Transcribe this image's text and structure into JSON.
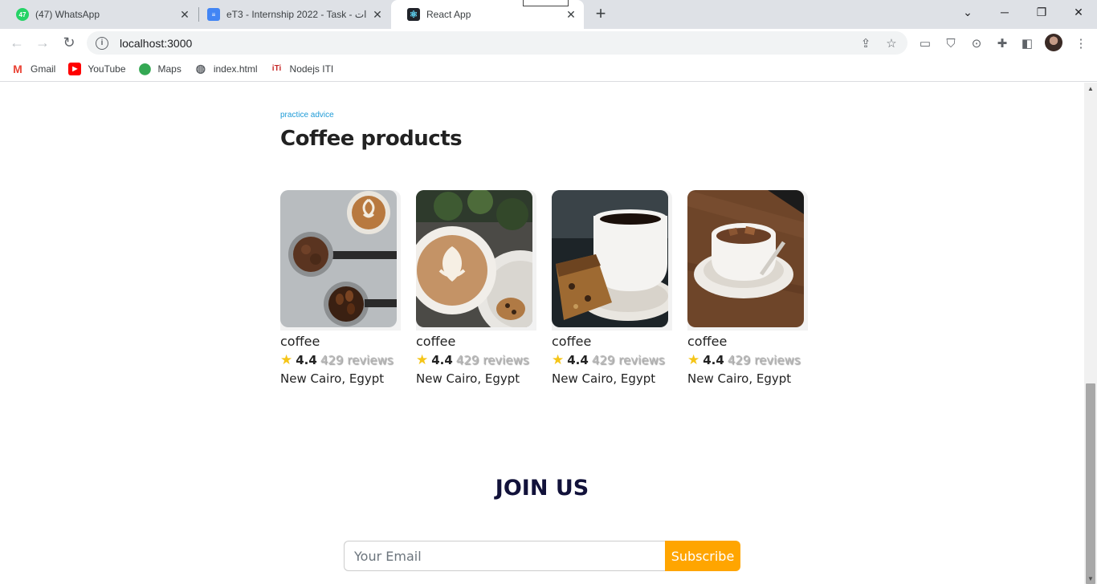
{
  "browser": {
    "tabs": [
      {
        "title": "(47) WhatsApp",
        "badge": "47",
        "favicon": "whatsapp-icon"
      },
      {
        "title": "eT3 - Internship 2022 - Task - ات",
        "favicon": "google-docs-icon"
      },
      {
        "title": "React App",
        "favicon": "react-icon"
      }
    ],
    "url": "localhost:3000",
    "bookmarks": [
      {
        "label": "Gmail",
        "icon": "gmail-icon"
      },
      {
        "label": "YouTube",
        "icon": "youtube-icon"
      },
      {
        "label": "Maps",
        "icon": "maps-icon"
      },
      {
        "label": "index.html",
        "icon": "globe-icon"
      },
      {
        "label": "Nodejs ITI",
        "icon": "iti-icon"
      }
    ]
  },
  "section": {
    "eyebrow": "practice advice",
    "title": "Coffee products"
  },
  "products": [
    {
      "name": "coffee",
      "rating": "4.4",
      "reviews": "429 reviews",
      "location": "New Cairo, Egypt",
      "image": "coffee-tools-photo"
    },
    {
      "name": "coffee",
      "rating": "4.4",
      "reviews": "429 reviews",
      "location": "New Cairo, Egypt",
      "image": "latte-art-photo"
    },
    {
      "name": "coffee",
      "rating": "4.4",
      "reviews": "429 reviews",
      "location": "New Cairo, Egypt",
      "image": "coffee-cake-photo"
    },
    {
      "name": "coffee",
      "rating": "4.4",
      "reviews": "429 reviews",
      "location": "New Cairo, Egypt",
      "image": "cup-on-table-photo"
    }
  ],
  "join": {
    "title": "JOIN US",
    "email_placeholder": "Your Email",
    "subscribe_label": "Subscribe"
  },
  "colors": {
    "accent": "#1e9bd7",
    "button": "#ffa500",
    "join_title": "#12123a",
    "star": "#f5c518"
  }
}
